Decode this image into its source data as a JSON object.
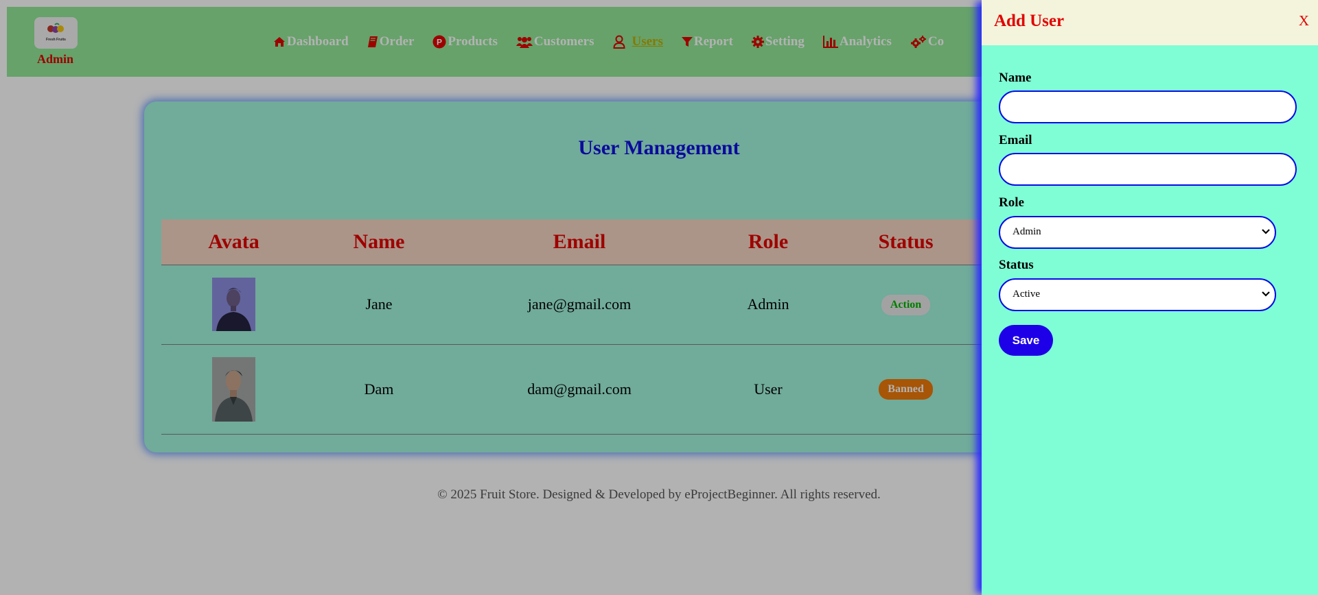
{
  "brand": {
    "logo_text": "Fresh Fruits",
    "admin_label": "Admin"
  },
  "nav": [
    {
      "label": "Dashboard",
      "icon": "home-icon"
    },
    {
      "label": "Order",
      "icon": "book-icon"
    },
    {
      "label": "Products",
      "icon": "product-hunt-icon"
    },
    {
      "label": "Customers",
      "icon": "users-icon"
    },
    {
      "label": "Users",
      "icon": "user-outline-icon",
      "active": true
    },
    {
      "label": "Report",
      "icon": "filter-icon"
    },
    {
      "label": "Setting",
      "icon": "gear-icon"
    },
    {
      "label": "Analytics",
      "icon": "bar-chart-icon"
    },
    {
      "label": "Co",
      "icon": "cogs-icon"
    }
  ],
  "main": {
    "title": "User Management",
    "columns": [
      "Avata",
      "Name",
      "Email",
      "Role",
      "Status"
    ],
    "rows": [
      {
        "name": "Jane",
        "email": "jane@gmail.com",
        "role": "Admin",
        "status": "Action"
      },
      {
        "name": "Dam",
        "email": "dam@gmail.com",
        "role": "User",
        "status": "Banned"
      }
    ]
  },
  "footer": {
    "text": "© 2025 Fruit Store. Designed & Developed by eProjectBeginner. All rights reserved."
  },
  "drawer": {
    "title": "Add User",
    "close_label": "X",
    "fields": {
      "name_label": "Name",
      "name_value": "",
      "email_label": "Email",
      "email_value": "",
      "role_label": "Role",
      "role_value": "Admin",
      "status_label": "Status",
      "status_value": "Active"
    },
    "save_label": "Save"
  },
  "colors": {
    "navbar": "#93e898",
    "accent_red": "#e20000",
    "title_blue": "#1010e0",
    "drawer_bg": "#7ffed6",
    "save_button": "#1e00e8",
    "banned": "#f07a0a"
  }
}
